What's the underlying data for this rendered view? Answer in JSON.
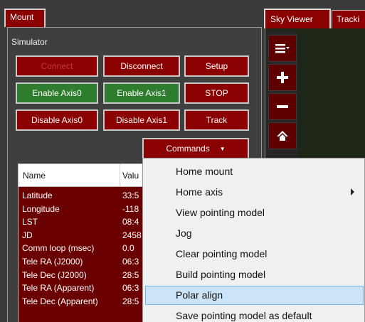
{
  "mount": {
    "tab_label": "Mount",
    "group_title": "Simulator",
    "buttons": {
      "connect": "Connect",
      "disconnect": "Disconnect",
      "setup": "Setup",
      "enable_axis0": "Enable Axis0",
      "enable_axis1": "Enable Axis1",
      "stop": "STOP",
      "disable_axis0": "Disable Axis0",
      "disable_axis1": "Disable Axis1",
      "track": "Track",
      "commands": "Commands"
    },
    "grid": {
      "columns": [
        "Name",
        "Valu"
      ],
      "rows": [
        {
          "name": "Latitude",
          "value": "33:5"
        },
        {
          "name": "Longitude",
          "value": "-118"
        },
        {
          "name": "LST",
          "value": "08:4"
        },
        {
          "name": "JD",
          "value": "2458"
        },
        {
          "name": "Comm loop (msec)",
          "value": "0.0"
        },
        {
          "name": "Tele RA (J2000)",
          "value": "06:3"
        },
        {
          "name": "Tele Dec (J2000)",
          "value": "28:5"
        },
        {
          "name": "Tele RA (Apparent)",
          "value": "06:3"
        },
        {
          "name": "Tele Dec (Apparent)",
          "value": "28:5"
        }
      ]
    }
  },
  "sky_viewer": {
    "tab_label": "Sky Viewer",
    "tracking_tab_label": "Tracki",
    "sidebar_icons": [
      "menu-icon",
      "zoom-in-icon",
      "zoom-out-icon",
      "home-icon"
    ]
  },
  "context_menu": {
    "items": [
      {
        "label": "Home mount",
        "submenu": false
      },
      {
        "label": "Home axis",
        "submenu": true
      },
      {
        "label": "View pointing model",
        "submenu": false
      },
      {
        "label": "Jog",
        "submenu": false
      },
      {
        "label": "Clear pointing model",
        "submenu": false
      },
      {
        "label": "Build pointing model",
        "submenu": false
      },
      {
        "label": "Polar align",
        "submenu": false,
        "selected": true
      },
      {
        "label": "Save pointing model as default",
        "submenu": false
      }
    ]
  },
  "colors": {
    "button_red": "#8b0000",
    "button_green": "#2e7d2e",
    "menu_highlight": "#cce4f7"
  }
}
